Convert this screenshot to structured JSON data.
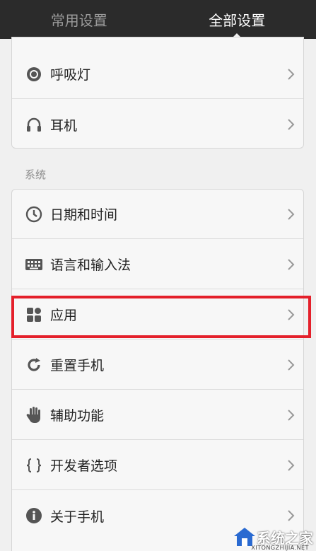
{
  "tabs": [
    {
      "label": "常用设置",
      "active": false
    },
    {
      "label": "全部设置",
      "active": true
    }
  ],
  "group1": {
    "items": [
      {
        "label": "呼吸灯",
        "icon": "breathing-light-icon"
      },
      {
        "label": "耳机",
        "icon": "headphones-icon"
      }
    ]
  },
  "section_system": "系统",
  "group2": {
    "items": [
      {
        "label": "日期和时间",
        "icon": "clock-icon"
      },
      {
        "label": "语言和输入法",
        "icon": "keyboard-icon"
      },
      {
        "label": "应用",
        "icon": "apps-icon",
        "highlighted": true
      },
      {
        "label": "重置手机",
        "icon": "reset-icon"
      },
      {
        "label": "辅助功能",
        "icon": "hand-icon"
      },
      {
        "label": "开发者选项",
        "icon": "braces-icon"
      },
      {
        "label": "关于手机",
        "icon": "info-icon"
      }
    ]
  },
  "watermark": {
    "text": "系统之家",
    "sub": "XITONGZHIJIA.NET"
  },
  "colors": {
    "tabbar": "#2b2b2b",
    "highlight": "#e4202b",
    "background": "#f0f0f0"
  }
}
